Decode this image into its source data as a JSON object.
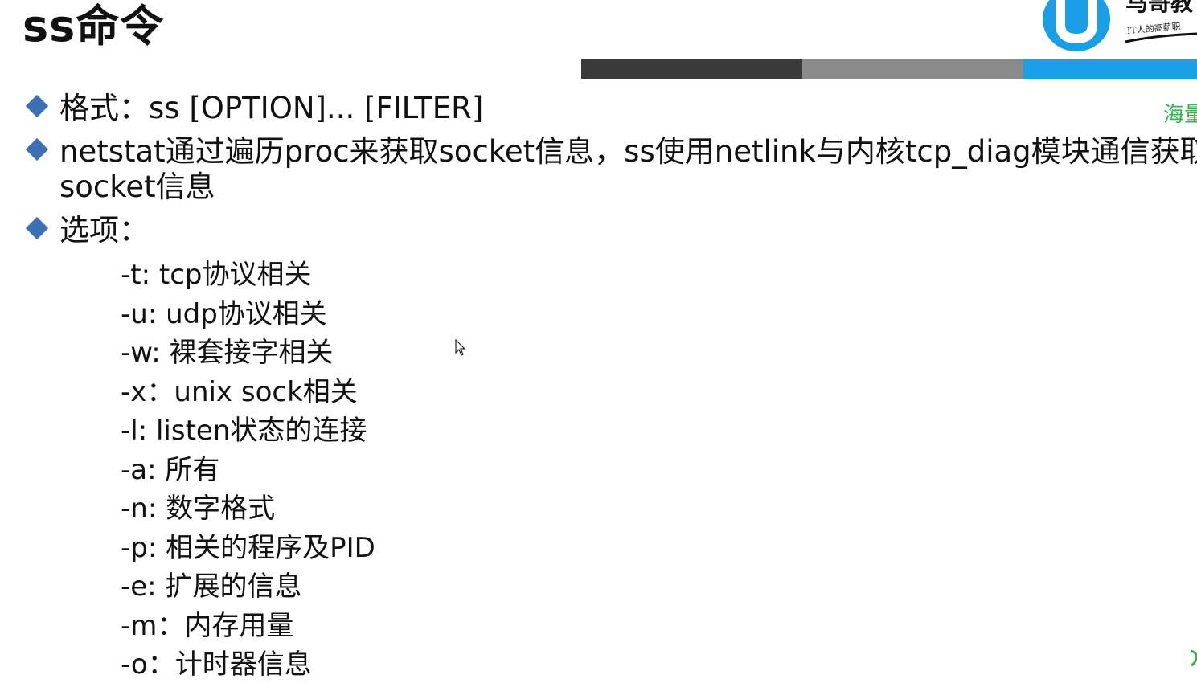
{
  "slide": {
    "title": "ss命令"
  },
  "logo": {
    "text": "马哥教",
    "tagline": "IT人的高薪职"
  },
  "header_bar": {
    "colors": [
      "#3a3a3a",
      "#8a8a8a",
      "#1aa0e8"
    ]
  },
  "side_note": "海量",
  "bullets": [
    {
      "text": "格式：ss [OPTION]... [FILTER]"
    },
    {
      "text": "netstat通过遍历proc来获取socket信息，ss使用netlink与内核tcp_diag模块通信获取",
      "continuation": "socket信息"
    },
    {
      "text": "选项："
    }
  ],
  "options": [
    "-t: tcp协议相关",
    "-u: udp协议相关",
    "-w: 裸套接字相关",
    "-x：unix sock相关",
    "-l: listen状态的连接",
    "-a: 所有",
    "-n: 数字格式",
    "-p: 相关的程序及PID",
    "-e: 扩展的信息",
    "-m：内存用量",
    "-o：计时器信息"
  ],
  "colors": {
    "bullet": "#3d6fb5",
    "accent_blue": "#1aa0e8",
    "note_green": "#3bb04a"
  }
}
